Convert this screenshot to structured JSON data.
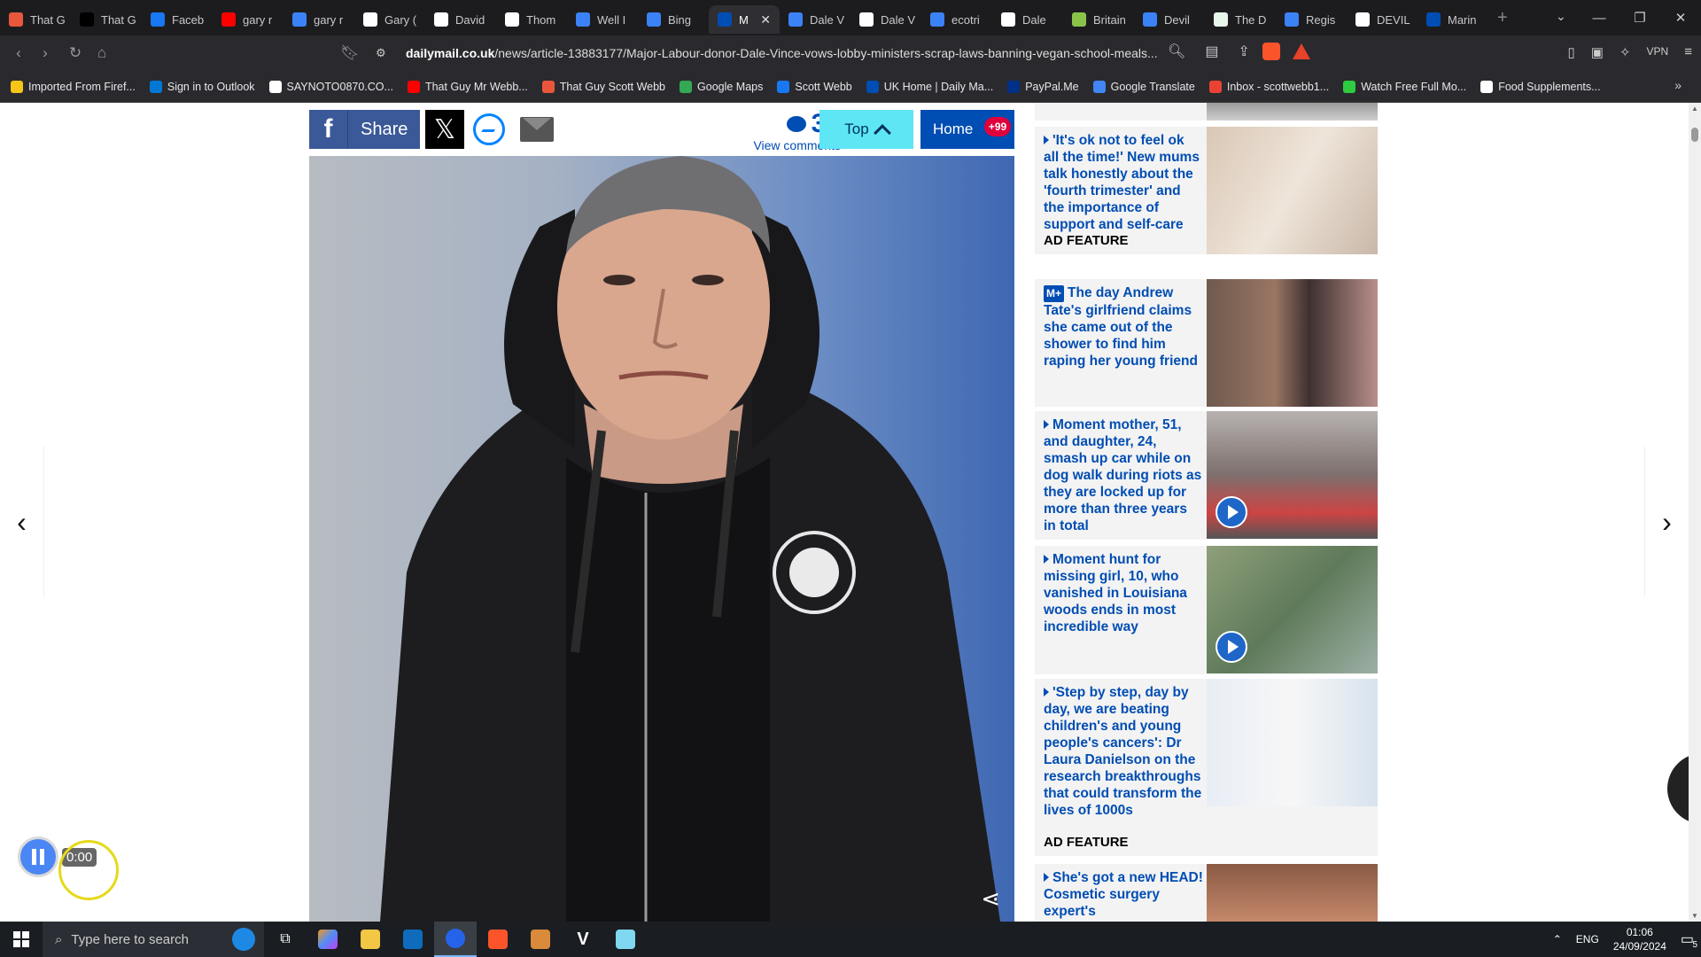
{
  "tabs": [
    {
      "label": "That G",
      "icon": "brave-icon",
      "color": "#e8573c"
    },
    {
      "label": "That G",
      "icon": "x-icon",
      "color": "#000000"
    },
    {
      "label": "Faceb",
      "icon": "facebook-icon",
      "color": "#1877f2"
    },
    {
      "label": "gary r",
      "icon": "youtube-icon",
      "color": "#ff0000"
    },
    {
      "label": "gary r",
      "icon": "search-icon",
      "color": "#3b82f6"
    },
    {
      "label": "Gary (",
      "icon": "wikipedia-icon",
      "color": "#ffffff"
    },
    {
      "label": "David",
      "icon": "wikipedia-icon",
      "color": "#ffffff"
    },
    {
      "label": "Thom",
      "icon": "wikipedia-icon",
      "color": "#ffffff"
    },
    {
      "label": "Well I",
      "icon": "search-icon",
      "color": "#3b82f6"
    },
    {
      "label": "Bing",
      "icon": "search-icon",
      "color": "#3b82f6"
    },
    {
      "label": "M",
      "icon": "dailymail-icon",
      "color": "#004db3",
      "active": true
    },
    {
      "label": "Dale V",
      "icon": "search-icon",
      "color": "#3b82f6"
    },
    {
      "label": "Dale V",
      "icon": "wikipedia-icon",
      "color": "#ffffff"
    },
    {
      "label": "ecotri",
      "icon": "search-icon",
      "color": "#3b82f6"
    },
    {
      "label": "Dale",
      "icon": "gov-icon",
      "color": "#ffffff"
    },
    {
      "label": "Britain",
      "icon": "ecotricity-icon",
      "color": "#8bc34a"
    },
    {
      "label": "Devil",
      "icon": "search-icon",
      "color": "#3b82f6"
    },
    {
      "label": "The D",
      "icon": "doc-icon",
      "color": "#e8f5e9"
    },
    {
      "label": "Regis",
      "icon": "search-icon",
      "color": "#3b82f6"
    },
    {
      "label": "DEVIL",
      "icon": "gov-icon",
      "color": "#ffffff"
    },
    {
      "label": "Marin",
      "icon": "dailymail-icon",
      "color": "#004db3"
    }
  ],
  "address": {
    "site": "dailymail.co.uk",
    "path": "/news/article-13883177/Major-Labour-donor-Dale-Vince-vows-lobby-ministers-scrap-laws-banning-vegan-school-meals..."
  },
  "vpn_label": "VPN",
  "bookmarks": [
    {
      "label": "Imported From Firef...",
      "color": "#f5c518"
    },
    {
      "label": "Sign in to Outlook",
      "color": "#0078d4"
    },
    {
      "label": "SAYNOTO0870.CO...",
      "color": "#ffffff"
    },
    {
      "label": "That Guy Mr Webb...",
      "color": "#ff0000"
    },
    {
      "label": "That Guy Scott Webb",
      "color": "#e8573c"
    },
    {
      "label": "Google Maps",
      "color": "#34a853"
    },
    {
      "label": "Scott Webb",
      "color": "#1877f2"
    },
    {
      "label": "UK Home | Daily Ma...",
      "color": "#004db3"
    },
    {
      "label": "PayPal.Me",
      "color": "#003087"
    },
    {
      "label": "Google Translate",
      "color": "#4285f4"
    },
    {
      "label": "Inbox - scottwebb1...",
      "color": "#ea4335"
    },
    {
      "label": "Watch Free Full Mo...",
      "color": "#2ecc40"
    },
    {
      "label": "Food Supplements...",
      "color": "#ffffff"
    }
  ],
  "share_bar": {
    "share_label": "Share",
    "comment_count": "35",
    "view_comments": "View comments",
    "top_label": "Top",
    "home_label": "Home",
    "home_badge": "+99"
  },
  "sidebar": [
    {
      "title": "'It's ok not to feel ok all the time!' New mums talk honestly about the 'fourth trimester' and the importance of support and self-care",
      "ad_feature": "AD FEATURE",
      "premium": false,
      "video": false
    },
    {
      "title": "The day Andrew Tate's girlfriend claims she came out of the shower to find him raping her young friend",
      "ad_feature": "",
      "premium": true,
      "premium_label": "M+",
      "video": false
    },
    {
      "title": "Moment mother, 51, and daughter, 24, smash up car while on dog walk during riots as they are locked up for more than three years in total",
      "ad_feature": "",
      "premium": false,
      "video": true
    },
    {
      "title": "Moment hunt for missing girl, 10, who vanished in Louisiana woods ends in most incredible way",
      "ad_feature": "",
      "premium": false,
      "video": true
    },
    {
      "title": "'Step by step, day by day, we are beating children's and young people's cancers': Dr Laura Danielson on the research breakthroughs that could transform the lives of 1000s",
      "ad_feature": "AD FEATURE",
      "premium": false,
      "video": false
    },
    {
      "title": "She's got a new HEAD! Cosmetic surgery expert's",
      "ad_feature": "",
      "premium": false,
      "video": false
    }
  ],
  "player": {
    "time": "0:00"
  },
  "taskbar": {
    "search_placeholder": "Type here to search",
    "lang": "ENG",
    "time": "01:06",
    "date": "24/09/2024",
    "notif_count": "5"
  }
}
